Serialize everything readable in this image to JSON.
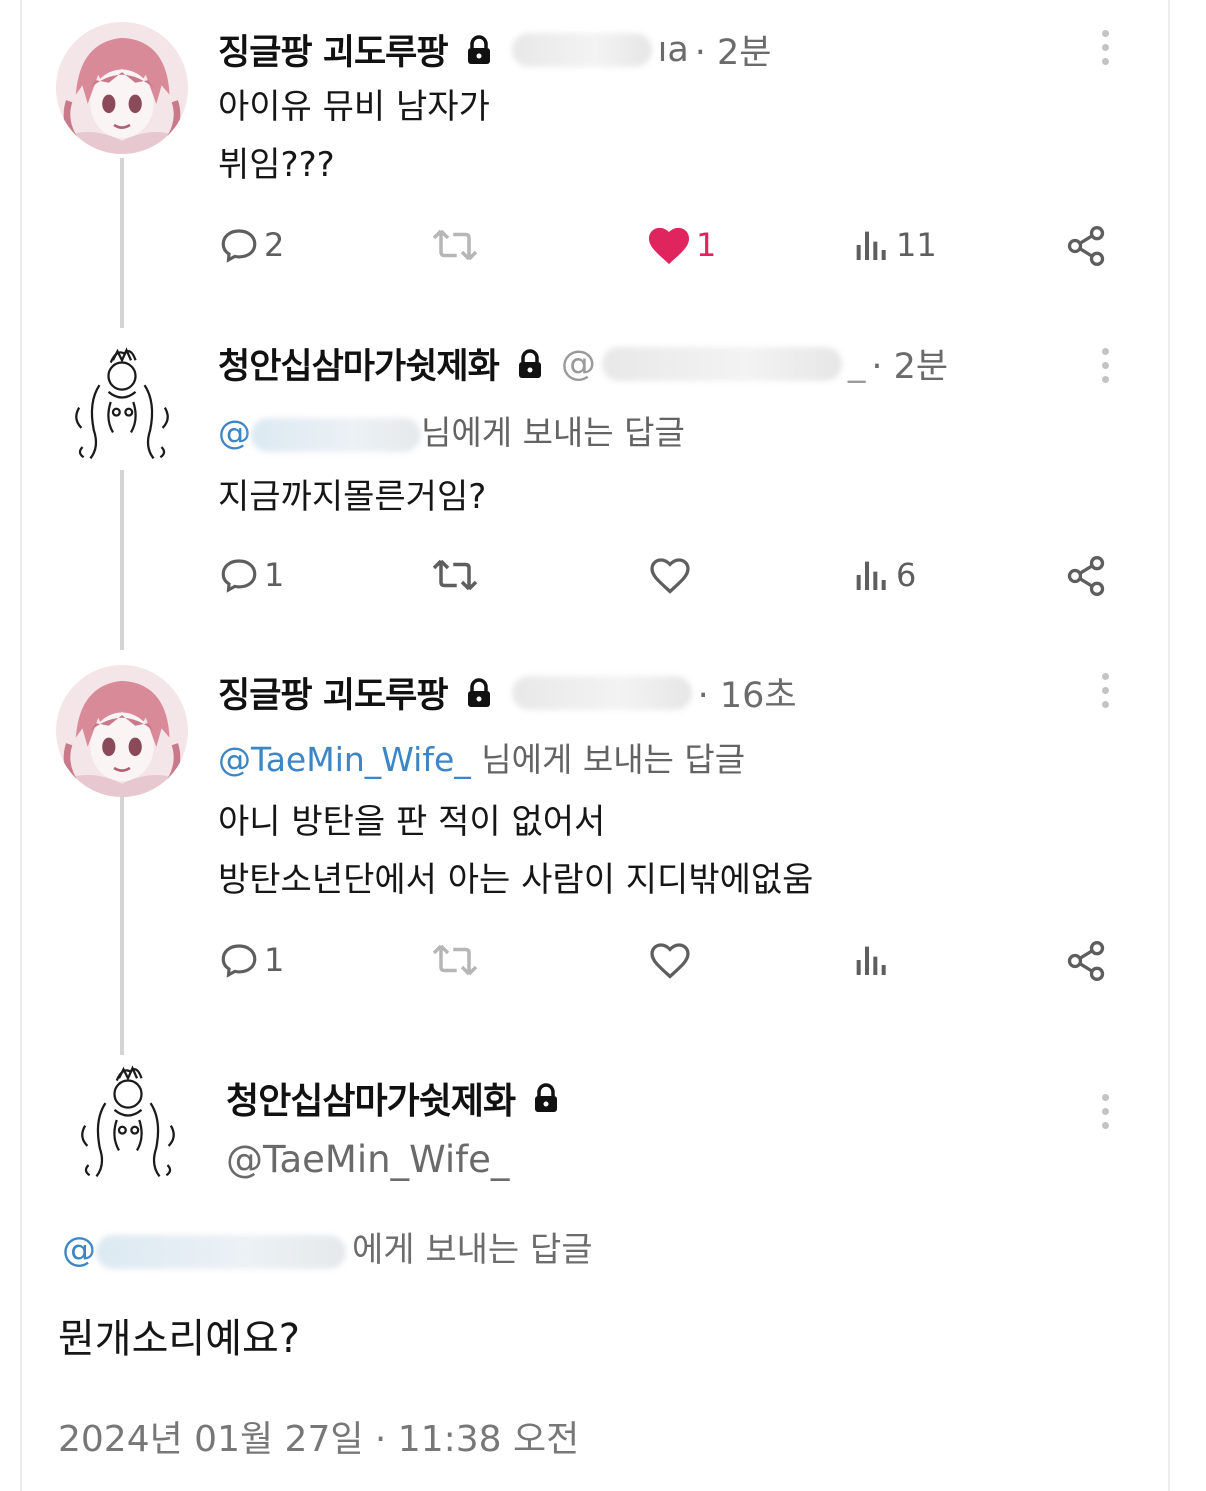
{
  "thread": [
    {
      "display_name": "징글팡 괴도루팡",
      "handle_visible": "ıa",
      "time": "· 2분",
      "reply_to_prefix": "",
      "reply_to_suffix": "",
      "lines": [
        "아이유 뮤비 남자가",
        "뷔임???"
      ],
      "stats": {
        "replies": "2",
        "retweets": "",
        "likes": "1",
        "views": "11"
      },
      "liked": true
    },
    {
      "display_name": "청안십삼마가쉿제화",
      "handle_visible": "@",
      "handle_tail": "_",
      "time": "· 2분",
      "reply_to_prefix": "@",
      "reply_to_suffix": "님에게 보내는 답글",
      "lines": [
        "지금까지몰른거임?"
      ],
      "stats": {
        "replies": "1",
        "retweets": "",
        "likes": "",
        "views": "6"
      },
      "liked": false
    },
    {
      "display_name": "징글팡 괴도루팡",
      "handle_visible": "",
      "time": "· 16초",
      "reply_to_prefix": "@TaeMin_Wife_",
      "reply_to_suffix": " 님에게 보내는 답글",
      "lines": [
        "아니 방탄을 판 적이 없어서",
        "방탄소년단에서 아는 사람이 지디밖에없움"
      ],
      "stats": {
        "replies": "1",
        "retweets": "",
        "likes": "",
        "views": ""
      },
      "liked": false
    }
  ],
  "main_tweet": {
    "display_name": "청안십삼마가쉿제화",
    "handle": "@TaeMin_Wife_",
    "reply_to_prefix": "@",
    "reply_to_suffix": "에게 보내는 답글",
    "text": "뭔개소리예요?",
    "timestamp": "2024년 01월 27일 · 11:38 오전"
  },
  "icons": {
    "reply": "reply-icon",
    "retweet": "retweet-icon",
    "like": "heart-icon",
    "views": "views-icon",
    "share": "share-icon",
    "lock": "lock-icon",
    "more": "more-icon"
  },
  "colors": {
    "like_active": "#e0245e",
    "mention": "#3d86c6",
    "muted": "#6b6b6b"
  }
}
